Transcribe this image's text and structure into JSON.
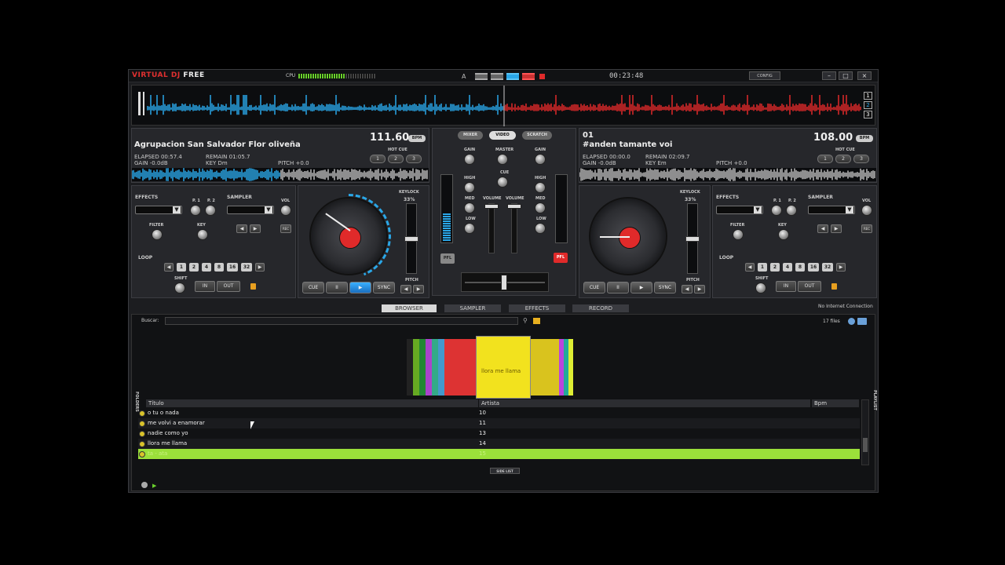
{
  "titlebar": {
    "logo_virtual": "VIRTUAL",
    "logo_dj": "DJ",
    "logo_free": "FREE",
    "cpu_label": "CPU",
    "layout_label": "A",
    "clock": "00:23:48",
    "config_label": "CONFIG",
    "minimize": "–",
    "maximize": "□",
    "close": "×"
  },
  "overview": {
    "deck_buttons": [
      "1",
      "2",
      "3"
    ]
  },
  "deck_left": {
    "title": "Agrupacion San Salvador Flor oliveña",
    "bpm": "111.60",
    "bpm_tag": "BPM",
    "elapsed": "ELAPSED 00:57.4",
    "remain": "REMAIN 01:05.7",
    "gain": "GAIN -0.0dB",
    "key": "KEY Dm",
    "pitch": "PITCH +0.0",
    "hotcue_label": "HOT CUE",
    "hotcues": [
      "1",
      "2",
      "3"
    ],
    "effects": "EFFECTS",
    "p1": "P. 1",
    "p2": "P. 2",
    "sampler": "SAMPLER",
    "vol": "VOL",
    "rec": "REC",
    "filter": "FILTER",
    "keyknob": "KEY",
    "loop": "LOOP",
    "loop_values": [
      "1",
      "2",
      "4",
      "8",
      "16",
      "32"
    ],
    "shift": "SHIFT",
    "in": "IN",
    "out": "OUT",
    "keylock": "KEYLOCK",
    "keylock_pct": "33%",
    "cue": "CUE",
    "pause": "II",
    "play": "▶",
    "sync": "SYNC",
    "pitch_label": "PITCH"
  },
  "deck_right": {
    "deck_number": "01",
    "title": "#anden tamante voi",
    "bpm": "108.00",
    "bpm_tag": "BPM",
    "elapsed": "ELAPSED 00:00.0",
    "remain": "REMAIN 02:09.7",
    "gain": "GAIN -0.0dB",
    "key": "KEY Em",
    "pitch": "PITCH +0.0",
    "hotcue_label": "HOT CUE",
    "hotcues": [
      "1",
      "2",
      "3"
    ],
    "effects": "EFFECTS",
    "p1": "P. 1",
    "p2": "P. 2",
    "sampler": "SAMPLER",
    "vol": "VOL",
    "rec": "REC",
    "filter": "FILTER",
    "keyknob": "KEY",
    "loop": "LOOP",
    "loop_values": [
      "1",
      "2",
      "4",
      "8",
      "16",
      "32"
    ],
    "shift": "SHIFT",
    "in": "IN",
    "out": "OUT",
    "keylock": "KEYLOCK",
    "keylock_pct": "33%",
    "cue": "CUE",
    "pause": "II",
    "play": "▶",
    "sync": "SYNC",
    "pitch_label": "PITCH"
  },
  "mixer": {
    "tabs": [
      "MIXER",
      "VIDEO",
      "SCRATCH"
    ],
    "gain": "GAIN",
    "master": "MASTER",
    "high": "HIGH",
    "cue": "CUE",
    "med": "MED",
    "volume": "VOLUME",
    "low": "LOW",
    "pfl": "PFL"
  },
  "browser_tabs": [
    "BROWSER",
    "SAMPLER",
    "EFFECTS",
    "RECORD"
  ],
  "connection": "No Internet Connection",
  "browser": {
    "search_label": "Buscar:",
    "search_value": "",
    "file_count": "17 files",
    "cover_text": "llora me llama",
    "columns": [
      "Título",
      "Artista",
      "Bpm"
    ],
    "rows": [
      {
        "title": "o tu o nada",
        "artist": "10"
      },
      {
        "title": "me volvi a enamorar",
        "artist": "11"
      },
      {
        "title": "nadie como yo",
        "artist": "13"
      },
      {
        "title": "llora me llama",
        "artist": "14"
      },
      {
        "title": "ta - ata",
        "artist": "15"
      }
    ],
    "sidelist": "SIDE LIST",
    "folders_tab": "FOLDERS",
    "playlist_tab": "PLAYLIST"
  },
  "colors": {
    "deck_left_wave": "#2aa7e8",
    "deck_right_wave": "#e02a2a",
    "highlight_row": "#9be03a",
    "cover_yellow": "#f2e21e"
  }
}
